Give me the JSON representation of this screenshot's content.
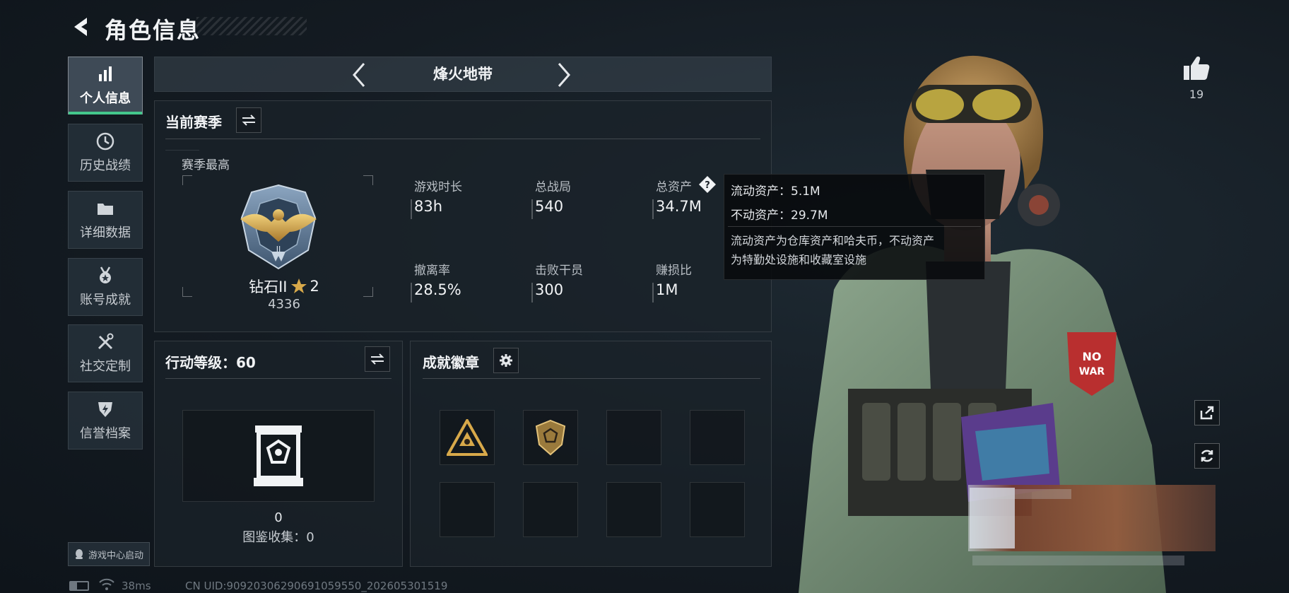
{
  "header": {
    "title": "角色信息"
  },
  "sidebar": {
    "items": [
      {
        "label": "个人信息",
        "icon": "bar-chart-icon",
        "active": true
      },
      {
        "label": "历史战绩",
        "icon": "clock-icon",
        "active": false
      },
      {
        "label": "详细数据",
        "icon": "folder-icon",
        "active": false
      },
      {
        "label": "账号成就",
        "icon": "medal-icon",
        "active": false
      },
      {
        "label": "社交定制",
        "icon": "tools-icon",
        "active": false
      },
      {
        "label": "信誉档案",
        "icon": "shield-bolt-icon",
        "active": false
      }
    ],
    "game_center_label": "游戏中心启动"
  },
  "mode": {
    "title": "烽火地带"
  },
  "season": {
    "title": "当前赛季",
    "best_label": "赛季最高",
    "rank_name": "钻石II",
    "rank_stars": "2",
    "rank_points": "4336",
    "stats": [
      {
        "label": "游戏时长",
        "value": "83h"
      },
      {
        "label": "总战局",
        "value": "540"
      },
      {
        "label": "总资产",
        "value": "34.7M"
      },
      {
        "label": "撤离率",
        "value": "28.5%"
      },
      {
        "label": "击败干员",
        "value": "300"
      },
      {
        "label": "赚损比",
        "value": "1M"
      }
    ]
  },
  "tooltip": {
    "liquid": "流动资产：5.1M",
    "fixed": "不动资产：29.7M",
    "desc_line1": "流动资产为仓库资产和哈夫币，不动资产",
    "desc_line2": "为特勤处设施和收藏室设施"
  },
  "action_level": {
    "title": "行动等级：60",
    "count": "0",
    "collection": "图鉴收集：0"
  },
  "badges": {
    "title": "成就徽章",
    "slots": [
      "triangle-badge",
      "shield-badge",
      "",
      "",
      "",
      "",
      "",
      ""
    ]
  },
  "profile": {
    "likes": "19"
  },
  "footer": {
    "ping": "38ms",
    "uid": "CN UID:9092030629069105955​0_202605301519"
  },
  "colors": {
    "accent_green": "#44c78c",
    "gold": "#d8a94a"
  }
}
